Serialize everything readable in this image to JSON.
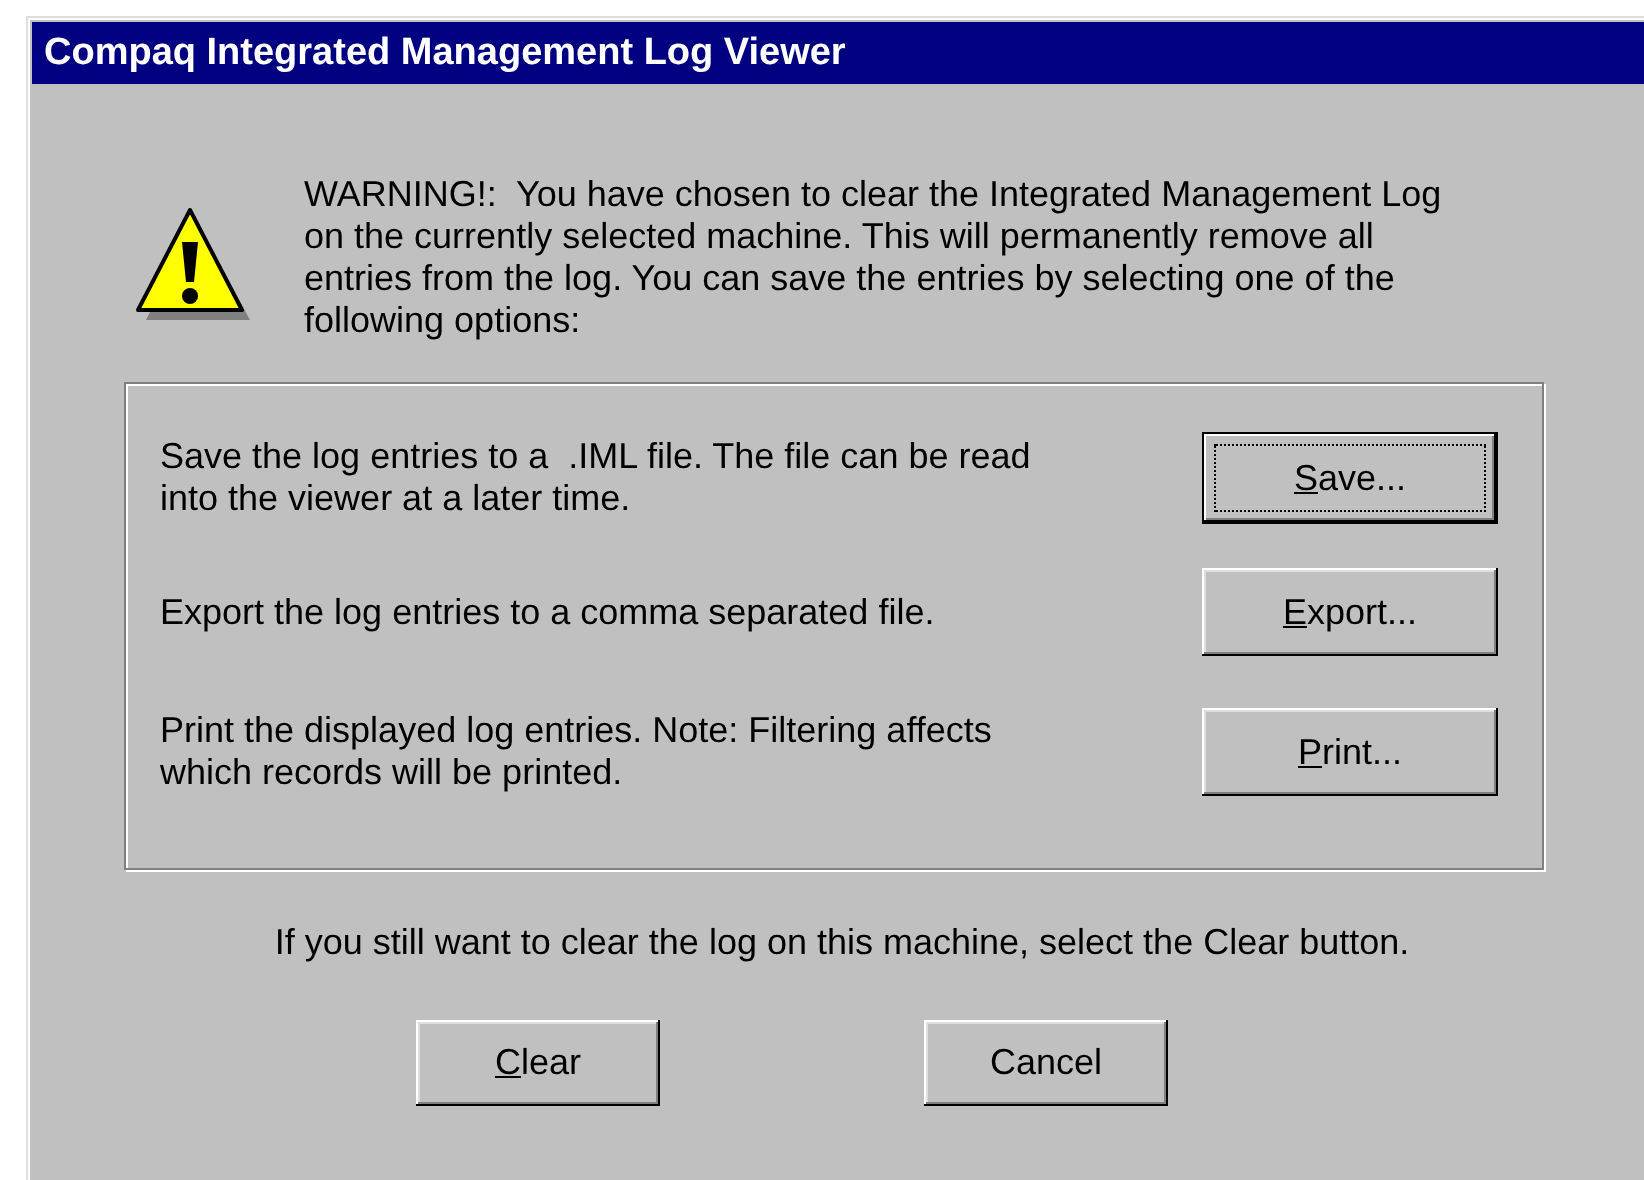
{
  "window": {
    "title": "Compaq Integrated Management Log Viewer"
  },
  "warning": "WARNING!:  You have chosen to clear the Integrated Management Log on the currently selected machine. This will permanently remove all entries from the log. You can save the entries by selecting one of the following options:",
  "options": [
    {
      "description": "Save the log entries to a  .IML file. The file can be read into the viewer at a later time.",
      "button": "Save...",
      "default": true,
      "mnemonic": true
    },
    {
      "description": "Export the log entries to a comma separated file.",
      "button": "Export...",
      "default": false,
      "mnemonic": true
    },
    {
      "description": "Print the displayed log entries. Note: Filtering affects which records will be printed.",
      "button": "Print...",
      "default": false,
      "mnemonic": true
    }
  ],
  "prompt": "If you still want to clear the log on this machine, select the Clear button.",
  "buttons": [
    {
      "label": "Clear",
      "mnemonic": true
    },
    {
      "label": "Cancel",
      "mnemonic": false
    }
  ]
}
